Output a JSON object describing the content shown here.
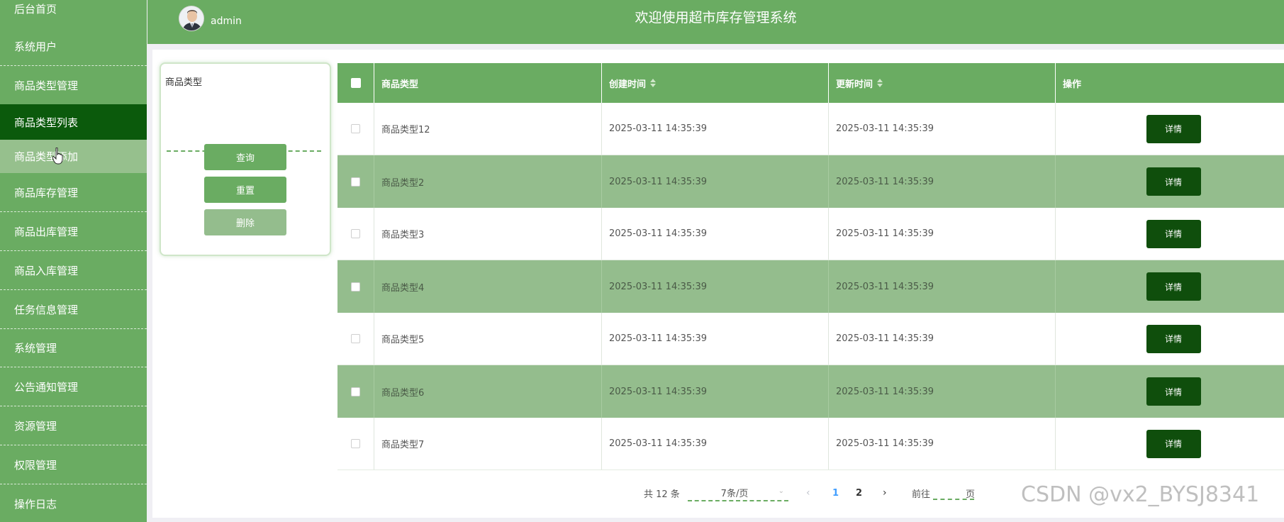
{
  "header": {
    "title": "欢迎使用超市库存管理系统",
    "user": "admin"
  },
  "sidebar": {
    "items": [
      {
        "label": "后台首页"
      },
      {
        "label": "系统用户"
      },
      {
        "label": "商品类型管理"
      },
      {
        "label": "商品类型列表"
      },
      {
        "label": "商品类型添加"
      },
      {
        "label": "商品库存管理"
      },
      {
        "label": "商品出库管理"
      },
      {
        "label": "商品入库管理"
      },
      {
        "label": "任务信息管理"
      },
      {
        "label": "系统管理"
      },
      {
        "label": "公告通知管理"
      },
      {
        "label": "资源管理"
      },
      {
        "label": "权限管理"
      },
      {
        "label": "操作日志"
      }
    ],
    "active_item": "商品类型列表",
    "hovered_item": "商品类型添加"
  },
  "search": {
    "field_label": "商品类型",
    "field_value": "",
    "query_button": "查询",
    "reset_button": "重置",
    "delete_button": "删除"
  },
  "table": {
    "headers": [
      "商品类型",
      "创建时间",
      "更新时间",
      "操作"
    ],
    "rows": [
      {
        "type": "商品类型12",
        "created": "2025-03-11 14:35:39",
        "updated": "2025-03-11 14:35:39",
        "action": "详情"
      },
      {
        "type": "商品类型2",
        "created": "2025-03-11 14:35:39",
        "updated": "2025-03-11 14:35:39",
        "action": "详情"
      },
      {
        "type": "商品类型3",
        "created": "2025-03-11 14:35:39",
        "updated": "2025-03-11 14:35:39",
        "action": "详情"
      },
      {
        "type": "商品类型4",
        "created": "2025-03-11 14:35:39",
        "updated": "2025-03-11 14:35:39",
        "action": "详情"
      },
      {
        "type": "商品类型5",
        "created": "2025-03-11 14:35:39",
        "updated": "2025-03-11 14:35:39",
        "action": "详情"
      },
      {
        "type": "商品类型6",
        "created": "2025-03-11 14:35:39",
        "updated": "2025-03-11 14:35:39",
        "action": "详情"
      },
      {
        "type": "商品类型7",
        "created": "2025-03-11 14:35:39",
        "updated": "2025-03-11 14:35:39",
        "action": "详情"
      }
    ]
  },
  "pagination": {
    "total_text": "共 12 条",
    "page_size": "7条/页",
    "pages": [
      "1",
      "2"
    ],
    "current_page": "1",
    "goto_label": "前往",
    "goto_unit": "页"
  },
  "watermark": "CSDN @vx2_BYSJ8341",
  "colors": {
    "primary": "#6aac62",
    "active_nav": "#0b5a0c",
    "button_dark": "#0f4e0c",
    "row_alt": "#94bd8d",
    "link": "#409eff"
  },
  "icons": {
    "avatar": "user-avatar-icon",
    "cursor": "hand-pointer-icon",
    "sort": "sort-caret-icon",
    "prev": "chevron-left-icon",
    "next": "chevron-right-icon",
    "dropdown": "chevron-down-icon"
  }
}
